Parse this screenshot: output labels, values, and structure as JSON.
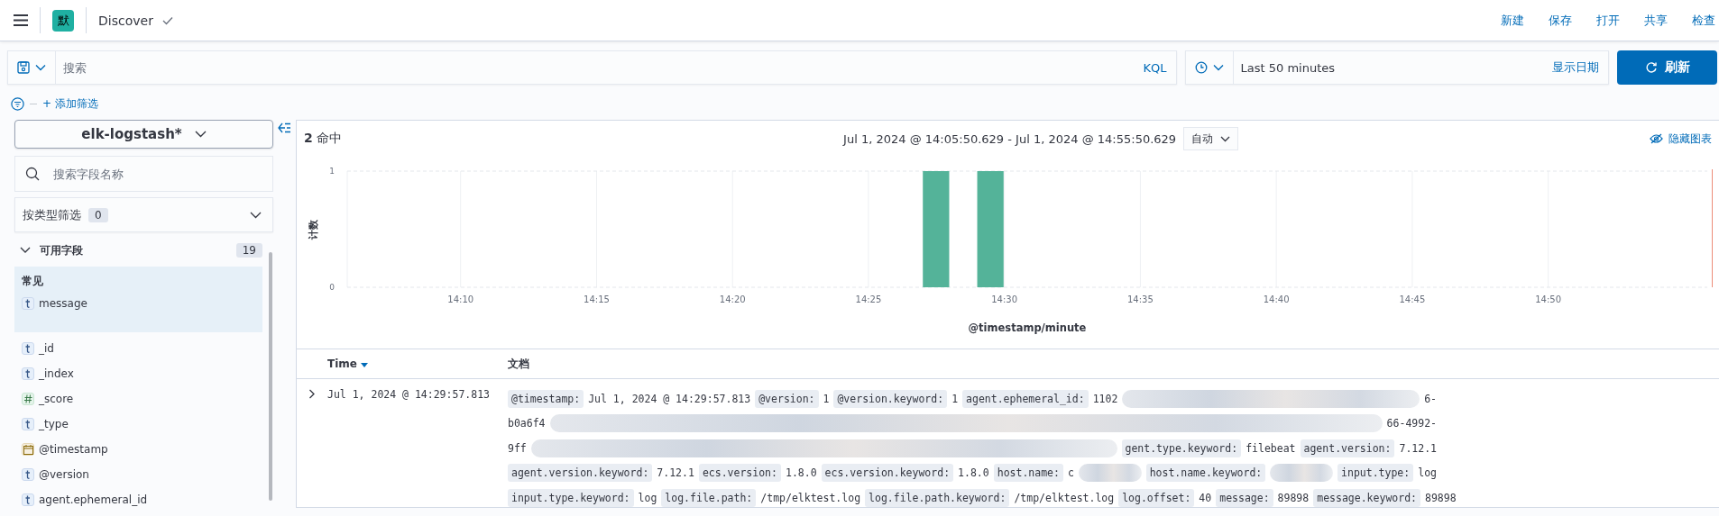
{
  "header": {
    "space_badge": "默",
    "app_title": "Discover",
    "actions": [
      "新建",
      "保存",
      "打开",
      "共享",
      "检查"
    ]
  },
  "query_bar": {
    "placeholder": "搜索",
    "language": "KQL",
    "time_range": "Last 50 minutes",
    "show_dates": "显示日期",
    "refresh": "刷新"
  },
  "filter_bar": {
    "add_filter": "+ 添加筛选"
  },
  "sidebar": {
    "index_pattern": "elk-logstash*",
    "field_search_placeholder": "搜索字段名称",
    "type_filter": {
      "label": "按类型筛选",
      "count": "0"
    },
    "available_fields": {
      "label": "可用字段",
      "count": "19",
      "expanded": true
    },
    "common": {
      "label": "常见",
      "fields": [
        {
          "kind": "string",
          "name": "message"
        }
      ]
    },
    "fields": [
      {
        "kind": "string",
        "name": "_id"
      },
      {
        "kind": "string",
        "name": "_index"
      },
      {
        "kind": "number",
        "name": "_score"
      },
      {
        "kind": "string",
        "name": "_type"
      },
      {
        "kind": "date",
        "name": "@timestamp"
      },
      {
        "kind": "string",
        "name": "@version"
      },
      {
        "kind": "string",
        "name": "agent.ephemeral_id"
      }
    ]
  },
  "histogram": {
    "hits": "2",
    "hits_label": "命中",
    "range": "Jul 1, 2024 @ 14:05:50.629 - Jul 1, 2024 @ 14:55:50.629",
    "interval": "自动",
    "hide_chart": "隐藏图表",
    "chart_data": {
      "type": "bar",
      "xlabel": "@timestamp/minute",
      "ylabel": "计数",
      "categories": [
        null,
        null,
        null,
        null,
        "14:10",
        null,
        null,
        null,
        null,
        "14:15",
        null,
        null,
        null,
        null,
        "14:20",
        null,
        null,
        null,
        null,
        "14:25",
        null,
        null,
        null,
        null,
        "14:30",
        null,
        null,
        null,
        null,
        "14:35",
        null,
        null,
        null,
        null,
        "14:40",
        null,
        null,
        null,
        null,
        "14:45",
        null,
        null,
        null,
        null,
        "14:50",
        null,
        null,
        null,
        null,
        null
      ],
      "ylim": [
        0,
        1
      ],
      "yticks": [
        0,
        1
      ],
      "grid": true,
      "series": [
        {
          "color": "#54b399",
          "values": [
            0,
            0,
            0,
            0,
            0,
            0,
            0,
            0,
            0,
            0,
            0,
            0,
            0,
            0,
            0,
            0,
            0,
            0,
            0,
            0,
            0,
            1,
            0,
            1,
            0,
            0,
            0,
            0,
            0,
            0,
            0,
            0,
            0,
            0,
            0,
            0,
            0,
            0,
            0,
            0,
            0,
            0,
            0,
            0,
            0,
            0,
            0,
            0,
            0,
            0
          ]
        }
      ]
    }
  },
  "table": {
    "columns": [
      {
        "label": "Time",
        "sorted": true
      },
      {
        "label": "文档",
        "sorted": false
      }
    ],
    "rows": [
      {
        "expanded": false,
        "time": "Jul 1, 2024 @ 14:29:57.813",
        "lines": [
          [
            {
              "kind": "pair",
              "key": "@timestamp:",
              "value": "Jul 1, 2024 @ 14:29:57.813"
            },
            {
              "kind": "pair",
              "key": "@version:",
              "value": "1"
            },
            {
              "kind": "pair",
              "key": "@version.keyword:",
              "value": "1"
            },
            {
              "kind": "pair",
              "key": "agent.ephemeral_id:",
              "value": "1102"
            },
            {
              "kind": "redacted"
            },
            {
              "kind": "text",
              "value": "6-"
            }
          ],
          [
            {
              "kind": "text",
              "value": "b0a6f4"
            },
            {
              "kind": "redacted"
            },
            {
              "kind": "text",
              "value": "66-4992-"
            }
          ],
          [
            {
              "kind": "text",
              "value": "9ff"
            },
            {
              "kind": "redacted"
            },
            {
              "kind": "pair",
              "key": "gent.type.keyword:",
              "value": "filebeat"
            },
            {
              "kind": "pair",
              "key": "agent.version:",
              "value": "7.12.1"
            }
          ],
          [
            {
              "kind": "pair",
              "key": "agent.version.keyword:",
              "value": "7.12.1"
            },
            {
              "kind": "pair",
              "key": "ecs.version:",
              "value": "1.8.0"
            },
            {
              "kind": "pair",
              "key": "ecs.version.keyword:",
              "value": "1.8.0"
            },
            {
              "kind": "pair",
              "key": "host.name:",
              "value": "c"
            },
            {
              "kind": "redacted"
            },
            {
              "kind": "pair",
              "key": "host.name.keyword:"
            },
            {
              "kind": "redacted"
            },
            {
              "kind": "pair",
              "key": "input.type:",
              "value": "log"
            }
          ],
          [
            {
              "kind": "pair",
              "key": "input.type.keyword:",
              "value": "log"
            },
            {
              "kind": "pair",
              "key": "log.file.path:",
              "value": "/tmp/elktest.log"
            },
            {
              "kind": "pair",
              "key": "log.file.path.keyword:",
              "value": "/tmp/elktest.log"
            },
            {
              "kind": "pair",
              "key": "log.offset:",
              "value": "40"
            },
            {
              "kind": "pair",
              "key": "message:",
              "value": "89898"
            },
            {
              "kind": "pair",
              "key": "message.keyword:",
              "value": "89898"
            }
          ]
        ]
      }
    ]
  }
}
